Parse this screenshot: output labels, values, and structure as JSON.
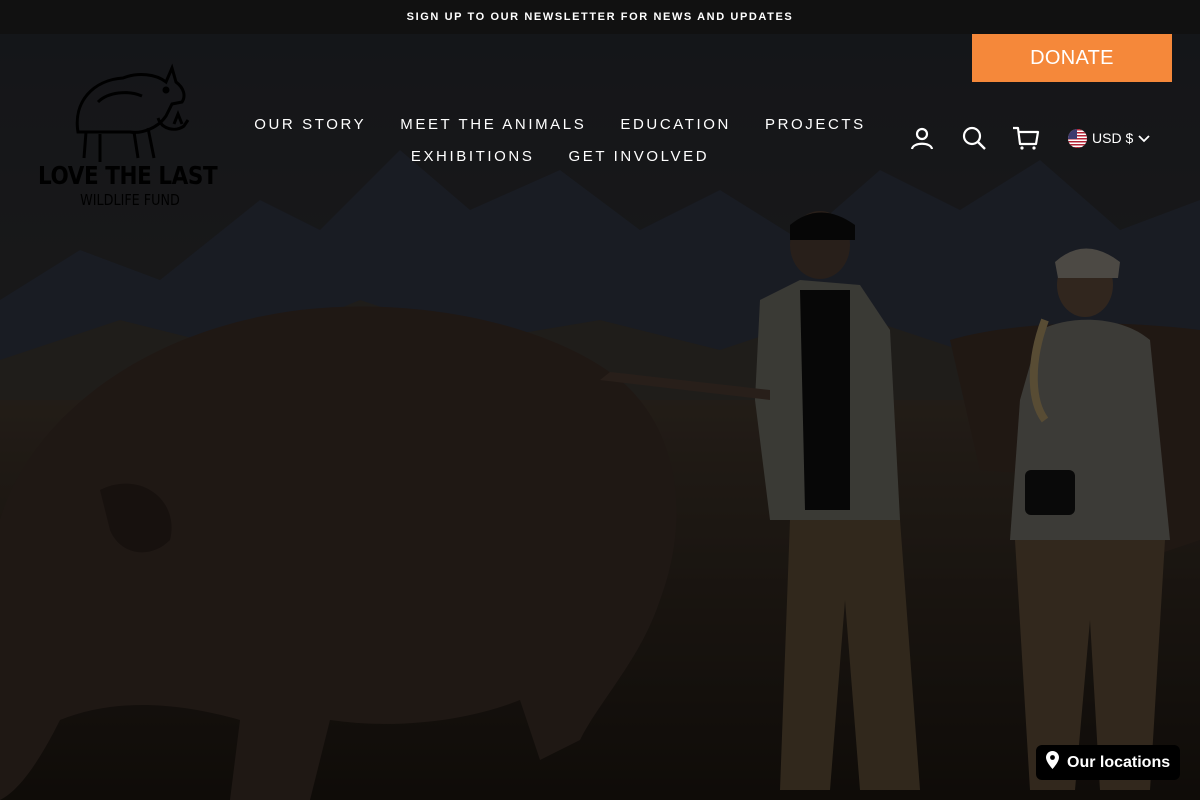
{
  "announcement": {
    "text": "SIGN UP TO OUR NEWSLETTER FOR NEWS AND UPDATES"
  },
  "donate": {
    "label": "DONATE"
  },
  "logo": {
    "line1": "LOVE THE LAST",
    "line2": "WILDLIFE FUND"
  },
  "nav": {
    "row1": [
      "OUR STORY",
      "MEET THE ANIMALS",
      "EDUCATION",
      "PROJECTS"
    ],
    "row2": [
      "EXHIBITIONS",
      "GET INVOLVED"
    ]
  },
  "header_icons": [
    "account-icon",
    "search-icon",
    "cart-icon"
  ],
  "currency": {
    "label": "USD $",
    "flag": "us-flag-icon"
  },
  "locations": {
    "label": "Our locations",
    "icon": "map-pin-icon"
  },
  "colors": {
    "donate": "#f5883a",
    "announcement_bg": "#111111",
    "overlay": "#000000"
  }
}
